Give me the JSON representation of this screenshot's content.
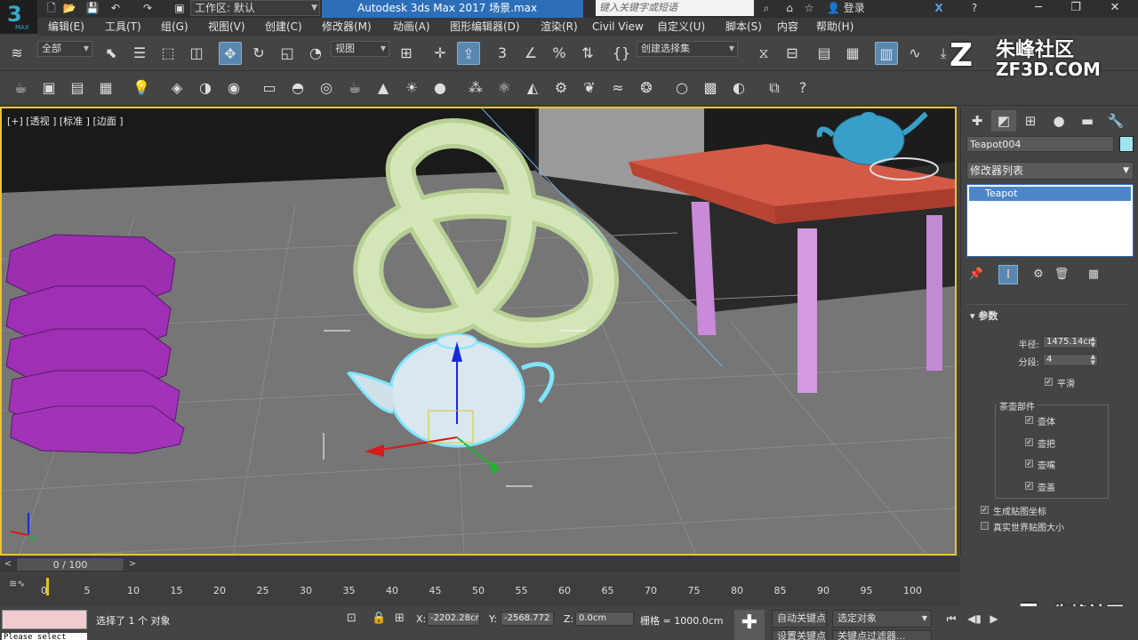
{
  "titlebar": {
    "logo_text": "3",
    "logo_sub": "MAX",
    "workspace_label": "工作区: 默认",
    "app_title": "Autodesk 3ds Max 2017    场景.max",
    "search_placeholder": "键入关键字或短语",
    "login_label": "登录"
  },
  "menubar": {
    "items": [
      "编辑(E)",
      "工具(T)",
      "组(G)",
      "视图(V)",
      "创建(C)",
      "修改器(M)",
      "动画(A)",
      "图形编辑器(D)",
      "渲染(R)",
      "Civil View",
      "自定义(U)",
      "脚本(S)",
      "内容",
      "帮助(H)"
    ]
  },
  "toolbar1": {
    "selection_filter": "全部",
    "ref_coord": "视图",
    "named_selection": "创建选择集"
  },
  "viewport": {
    "label": "[+] [透视 ] [标准 ] [边面 ]"
  },
  "watermark": {
    "brand": "朱峰社区",
    "url": "ZF3D.COM"
  },
  "command_panel": {
    "object_name": "Teapot004",
    "object_color": "#a0e4f0",
    "modifier_list": "修改器列表",
    "stack_item": "Teapot",
    "params_title": "参数",
    "radius_label": "半径:",
    "radius_value": "1475.14cr",
    "segments_label": "分段:",
    "segments_value": "4",
    "smooth_label": "平滑",
    "parts_title": "茶壶部件",
    "parts": [
      "壶体",
      "壶把",
      "壶嘴",
      "壶盖"
    ],
    "gen_map_coords": "生成贴图坐标",
    "real_world_map": "真实世界贴图大小"
  },
  "timeline": {
    "frame_display": "0 / 100",
    "ticks": [
      "0",
      "5",
      "10",
      "15",
      "20",
      "25",
      "30",
      "35",
      "40",
      "45",
      "50",
      "55",
      "60",
      "65",
      "70",
      "75",
      "80",
      "85",
      "90",
      "95",
      "100"
    ]
  },
  "statusbar": {
    "maxscript": "Please select",
    "message": "选择了 1 个 对象",
    "x_label": "X:",
    "x_value": "-2202.28cr",
    "y_label": "Y:",
    "y_value": "-2568.772",
    "z_label": "Z:",
    "z_value": "0.0cm",
    "grid_label": "栅格 = 1000.0cm",
    "auto_key": "自动关键点",
    "selected_obj": "选定对象",
    "set_key": "设置关键点",
    "key_filters": "关键点过滤器..."
  }
}
